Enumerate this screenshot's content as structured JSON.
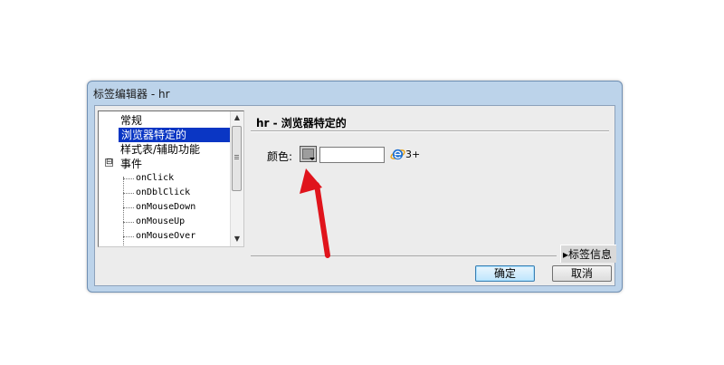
{
  "window": {
    "title": "标签编辑器 - hr"
  },
  "tree": {
    "items": [
      {
        "label": "常规"
      },
      {
        "label": "浏览器特定的",
        "selected": true
      },
      {
        "label": "样式表/辅助功能"
      },
      {
        "label": "事件",
        "expander": "⊟"
      },
      {
        "label": "onClick"
      },
      {
        "label": "onDblClick"
      },
      {
        "label": "onMouseDown"
      },
      {
        "label": "onMouseUp"
      },
      {
        "label": "onMouseOver"
      }
    ]
  },
  "panel": {
    "title": "hr - 浏览器特定的",
    "color_label": "颜色:",
    "color_value": "",
    "browser_version": "3+"
  },
  "tag_info_label": "标签信息",
  "buttons": {
    "ok": "确定",
    "cancel": "取消"
  },
  "colors": {
    "accent": "#0a36c4",
    "arrow": "#e0141c"
  }
}
